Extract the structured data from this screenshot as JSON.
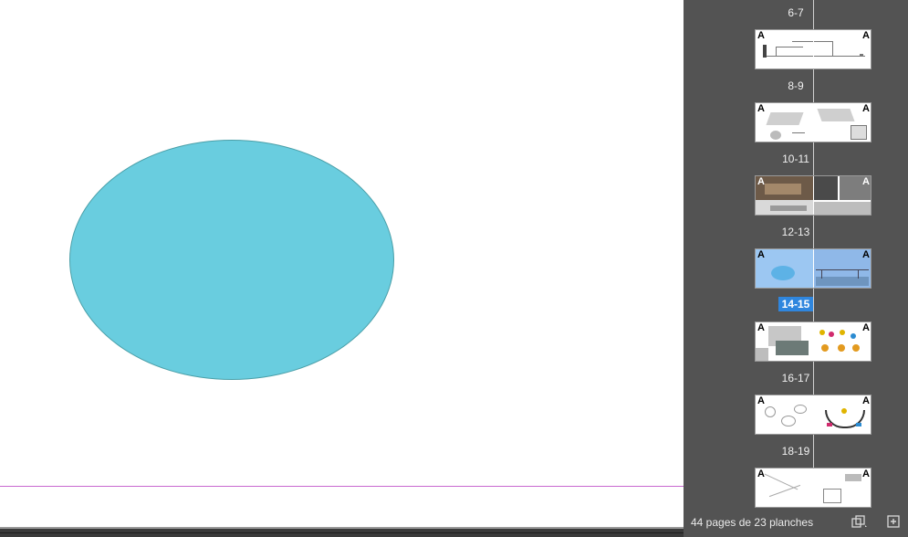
{
  "document": {
    "ellipse_fill": "#69cddf",
    "ellipse_stroke": "#4a9fa8",
    "guide_color": "#c86ad0"
  },
  "pages_panel": {
    "spreads": [
      {
        "label": "6-7",
        "selected": false
      },
      {
        "label": "8-9",
        "selected": false
      },
      {
        "label": "10-11",
        "selected": false
      },
      {
        "label": "12-13",
        "selected": false
      },
      {
        "label": "14-15",
        "selected": true
      },
      {
        "label": "16-17",
        "selected": false
      },
      {
        "label": "18-19",
        "selected": false
      }
    ],
    "master_prefix": "A",
    "selection_color": "#2f86de",
    "footer_text": "44 pages de 23 planches",
    "icons": [
      "edit-page-size-icon",
      "new-page-icon"
    ]
  }
}
